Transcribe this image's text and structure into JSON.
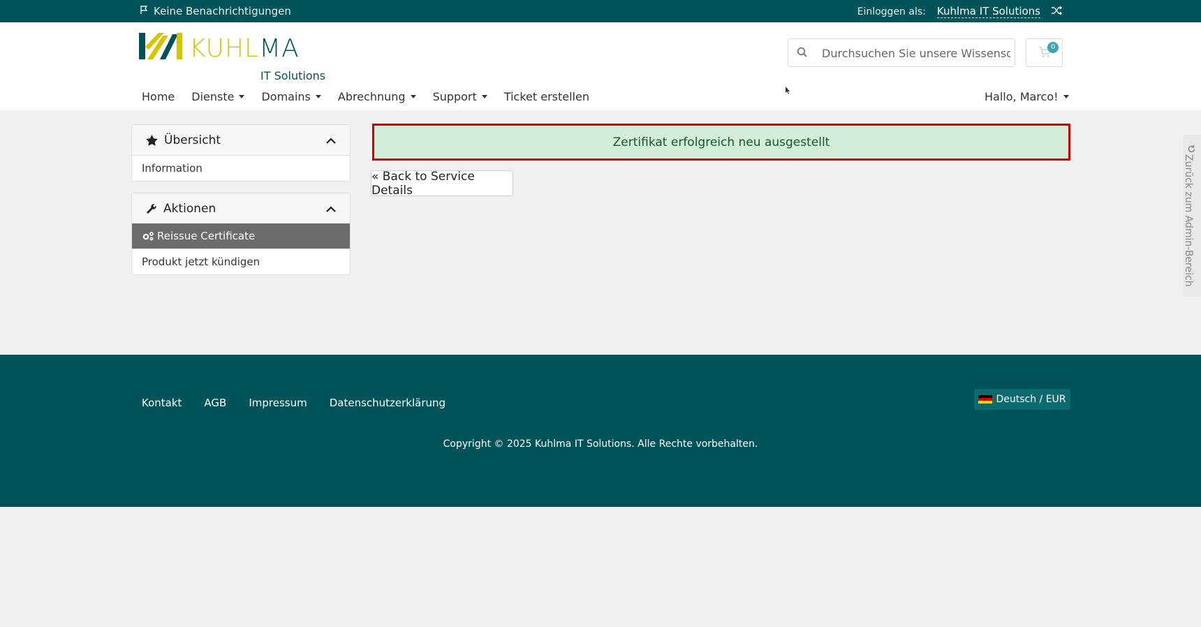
{
  "topbar": {
    "notifications": "Keine Benachrichtigungen",
    "logged_in_label": "Einloggen als:",
    "account": "Kuhlma IT Solutions"
  },
  "logo": {
    "word_part1": "KUHL",
    "word_part2": "MA",
    "subtitle": "IT Solutions"
  },
  "search": {
    "placeholder": "Durchsuchen Sie unsere Wissensdatenbank..."
  },
  "cart": {
    "count": "0"
  },
  "nav": {
    "items": [
      "Home",
      "Dienste",
      "Domains",
      "Abrechnung",
      "Support",
      "Ticket erstellen"
    ],
    "greeting": "Hallo, Marco!"
  },
  "sidebar": {
    "overview": {
      "title": "Übersicht",
      "items": [
        "Information"
      ]
    },
    "actions": {
      "title": "Aktionen",
      "items": [
        "Reissue Certificate",
        "Produkt jetzt kündigen"
      ]
    }
  },
  "main": {
    "alert": "Zertifikat erfolgreich neu ausgestellt",
    "back_button": "« Back to Service Details"
  },
  "admin_tab": "Zurück zum Admin-Bereich",
  "footer": {
    "links": [
      "Kontakt",
      "AGB",
      "Impressum",
      "Datenschutzerklärung"
    ],
    "language": "Deutsch / EUR",
    "copyright": "Copyright © 2025 Kuhlma IT Solutions. Alle Rechte vorbehalten."
  },
  "colors": {
    "brand": "#005459",
    "accent": "#d7c400",
    "alert_bg": "#d4edda",
    "alert_border": "#d40000"
  }
}
